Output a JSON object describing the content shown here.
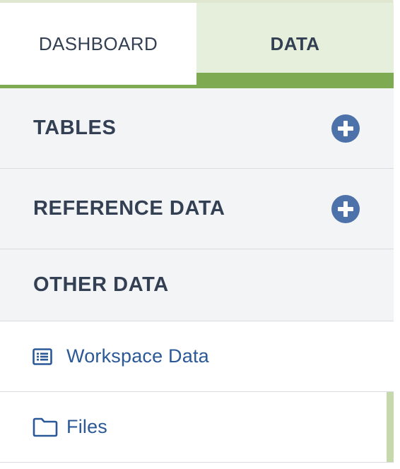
{
  "tabs": {
    "dashboard_label": "DASHBOARD",
    "data_label": "DATA"
  },
  "sections": {
    "tables_title": "TABLES",
    "reference_title": "REFERENCE DATA",
    "other_title": "OTHER DATA"
  },
  "items": {
    "workspace_label": "Workspace Data",
    "files_label": "Files"
  },
  "icons": {
    "tables_add": "plus-circle-icon",
    "reference_add": "plus-circle-icon",
    "workspace": "list-alt-icon",
    "files": "folder-icon"
  },
  "colors": {
    "accent_green": "#7eab51",
    "active_tab_bg": "#e6efdb",
    "link_blue": "#2b5897",
    "button_blue": "#4d72aa",
    "heading": "#333f52"
  }
}
